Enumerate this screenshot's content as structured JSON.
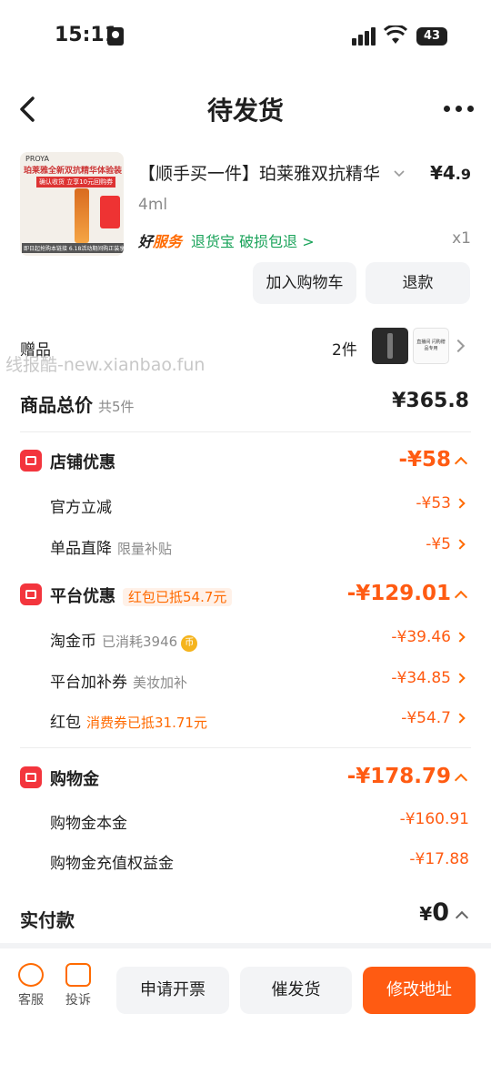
{
  "status_bar": {
    "time": "15:11",
    "battery": "43"
  },
  "nav": {
    "title": "待发货"
  },
  "product": {
    "name": "【顺手买一件】珀莱雅双抗精华",
    "price_symbol": "¥",
    "price_int": "4",
    "price_dec": ".9",
    "spec": "4ml",
    "service_brand_a": "好",
    "service_brand_b": "服务",
    "service_items": "退货宝  破损包退 >",
    "quantity": "x1",
    "thumb_brand": "PROYA",
    "thumb_head": "珀莱雅全新双抗精华体验装",
    "thumb_sub": "确认收货 立享10元回购券",
    "thumb_tag": "即日起抢购本链接 6.18活动期间购正装享优惠",
    "add_cart_label": "加入购物车",
    "refund_label": "退款"
  },
  "gifts": {
    "label": "赠品",
    "count": "2件",
    "gift2_text": "直播间 闪购赠品专用"
  },
  "watermark": "线报酷-new.xianbao.fun",
  "total": {
    "label": "商品总价",
    "count": "共5件",
    "value": "¥365.8"
  },
  "store_discount": {
    "title": "店铺优惠",
    "amount": "-¥58",
    "items": [
      {
        "label": "官方立减",
        "note": "",
        "amount": "-¥53"
      },
      {
        "label": "单品直降",
        "note": "限量补贴",
        "amount": "-¥5"
      }
    ]
  },
  "platform_discount": {
    "title": "平台优惠",
    "tag": "红包已抵54.7元",
    "amount": "-¥129.01",
    "items": [
      {
        "label": "淘金币",
        "note": "已消耗3946",
        "amount": "-¥39.46"
      },
      {
        "label": "平台加补券",
        "note": "美妆加补",
        "amount": "-¥34.85"
      },
      {
        "label": "红包",
        "note": "消费券已抵31.71元",
        "amount": "-¥54.7"
      }
    ]
  },
  "shopping_gold": {
    "title": "购物金",
    "amount": "-¥178.79",
    "items": [
      {
        "label": "购物金本金",
        "amount": "-¥160.91"
      },
      {
        "label": "购物金充值权益金",
        "amount": "-¥17.88"
      }
    ]
  },
  "paid": {
    "label": "实付款",
    "symbol": "¥",
    "value": "0"
  },
  "bottom": {
    "service_label": "客服",
    "complaint_label": "投诉",
    "invoice_label": "申请开票",
    "urge_label": "催发货",
    "modify_label": "修改地址"
  },
  "colors": {
    "accent": "#ff5b12",
    "green": "#1aa35a",
    "red_icon": "#f3353d"
  },
  "icons": [
    "back-icon",
    "more-icon",
    "chevron-right-icon",
    "chevron-up-icon",
    "store-icon",
    "platform-icon",
    "wallet-icon",
    "service-icon",
    "complaint-icon",
    "coin-icon"
  ]
}
